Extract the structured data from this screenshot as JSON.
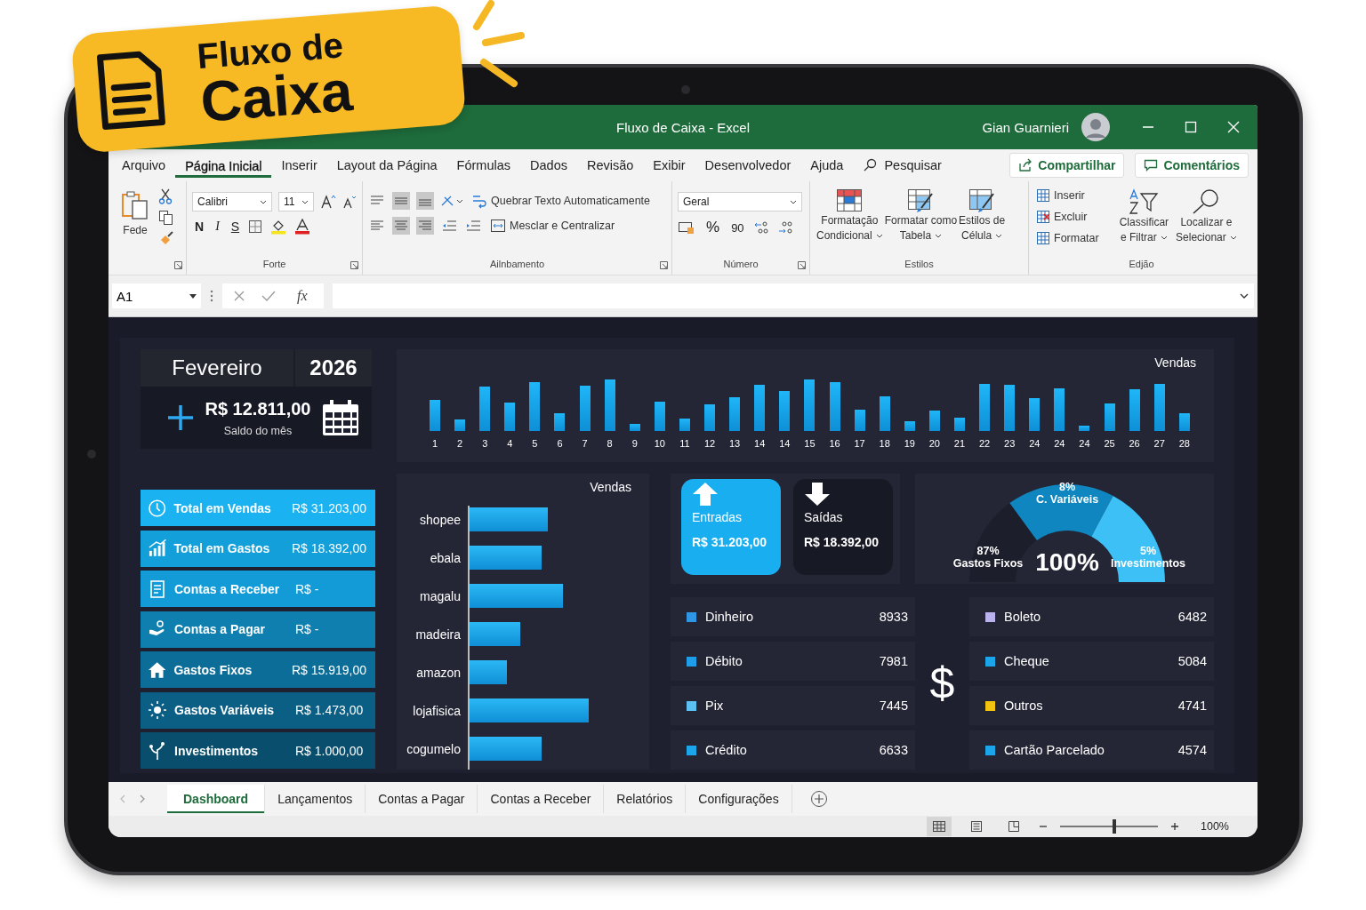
{
  "badge": {
    "line_1": "Fluxo de",
    "line_2": "Caixa"
  },
  "window": {
    "title": "Fluxo de Caixa - Excel",
    "user": "Gian Guarnieri"
  },
  "menu": {
    "tabs": [
      {
        "label": "Arquivo",
        "selected": false
      },
      {
        "label": "Página Inicial",
        "selected": true
      },
      {
        "label": "Inserir",
        "selected": false
      },
      {
        "label": "Layout da Página",
        "selected": false
      },
      {
        "label": "Fórmulas",
        "selected": false
      },
      {
        "label": "Dados",
        "selected": false
      },
      {
        "label": "Revisão",
        "selected": false
      },
      {
        "label": "Exibir",
        "selected": false
      },
      {
        "label": "Desenvolvedor",
        "selected": false
      },
      {
        "label": "Ajuda",
        "selected": false
      }
    ],
    "search": "Pesquisar",
    "share": "Compartilhar",
    "comments": "Comentários"
  },
  "ribbon": {
    "clipboard": {
      "paste": "Fede"
    },
    "font": {
      "family": "Calibri",
      "size": "11",
      "bold": "N",
      "italic": "I",
      "underline": "S",
      "label": "Forte"
    },
    "alignment": {
      "wrap": "Quebrar Texto Automaticamente",
      "merge": "Mesclar e Centralizar",
      "label": "Ailnbamento"
    },
    "number": {
      "format": "Geral",
      "percent": "%",
      "thousands": "90",
      "label": "Número"
    },
    "styles": {
      "items": [
        {
          "line_1": "Formatação",
          "line_2": "Condicional"
        },
        {
          "line_1": "Formatar como",
          "line_2": "Tabela"
        },
        {
          "line_1": "Estilos de",
          "line_2": "Célula"
        }
      ],
      "label": "Estilos"
    },
    "editing": {
      "cells": [
        "Inserir",
        "Excluir",
        "Formatar"
      ],
      "items": [
        {
          "line_1": "Classificar",
          "line_2": "e Filtrar"
        },
        {
          "line_1": "Localizar e",
          "line_2": "Selecionar"
        }
      ],
      "label": "Edjão"
    }
  },
  "formula_bar": {
    "name_box": "A1",
    "fx": "fx"
  },
  "dashboard": {
    "month": "Fevereiro",
    "year": "2026",
    "balance": "R$ 12.811,00",
    "balance_label": "Saldo do mês",
    "daily_chart": {
      "title": "Vendas",
      "labels": [
        "1",
        "2",
        "3",
        "4",
        "5",
        "6",
        "7",
        "8",
        "9",
        "10",
        "11",
        "12",
        "13",
        "14",
        "14",
        "15",
        "16",
        "17",
        "18",
        "19",
        "20",
        "21",
        "22",
        "23",
        "24",
        "24",
        "24",
        "25",
        "26",
        "27",
        "28"
      ]
    },
    "summary": [
      {
        "label": "Total em Vendas",
        "value": "R$ 31.203,00",
        "color": "#1ab2f0"
      },
      {
        "label": "Total em Gastos",
        "value": "R$ 18.392,00",
        "color": "#139fda"
      },
      {
        "label": "Contas a Receber",
        "value": "R$ -",
        "color": "#129bd6"
      },
      {
        "label": "Contas a Pagar",
        "value": "R$ -",
        "color": "#0e7fae"
      },
      {
        "label": "Gastos Fixos",
        "value": "R$ 15.919,00",
        "color": "#0c6e98"
      },
      {
        "label": "Gastos Variáveis",
        "value": "R$ 1.473,00",
        "color": "#0b5f84"
      },
      {
        "label": "Investimentos",
        "value": "R$ 1.000,00",
        "color": "#0a4e6d"
      }
    ],
    "platform_chart": {
      "title": "Vendas",
      "categories": [
        "shopee",
        "ebala",
        "magalu",
        "madeira",
        "amazon",
        "lojafisica",
        "cogumelo"
      ]
    },
    "flows": [
      {
        "label": "Entradas",
        "value": "R$ 31.203,00",
        "selected": true
      },
      {
        "label": "Saídas",
        "value": "R$ 18.392,00",
        "selected": false
      }
    ],
    "gauge": {
      "total": "100%",
      "segments": [
        {
          "percent": "87%",
          "label": "Gastos Fixos"
        },
        {
          "percent": "8%",
          "label": "C. Variáveis"
        },
        {
          "percent": "5%",
          "label": "Investimentos"
        }
      ]
    },
    "currency_sign": "$",
    "payments_left": [
      {
        "label": "Dinheiro",
        "value": "8933",
        "color": "#2f96e6"
      },
      {
        "label": "Débito",
        "value": "7981",
        "color": "#1e9ee8"
      },
      {
        "label": "Pix",
        "value": "7445",
        "color": "#5cc0f2"
      },
      {
        "label": "Crédito",
        "value": "6633",
        "color": "#1aa6e8"
      }
    ],
    "payments_right": [
      {
        "label": "Boleto",
        "value": "6482",
        "color": "#b9b2ee"
      },
      {
        "label": "Cheque",
        "value": "5084",
        "color": "#1aa6e8"
      },
      {
        "label": "Outros",
        "value": "4741",
        "color": "#f2c40f"
      },
      {
        "label": "Cartão Parcelado",
        "value": "4574",
        "color": "#1aa6e8"
      }
    ]
  },
  "sheet_tabs": [
    {
      "label": "Dashboard",
      "selected": true
    },
    {
      "label": "Lançamentos",
      "selected": false
    },
    {
      "label": "Contas a Pagar",
      "selected": false
    },
    {
      "label": "Contas a Receber",
      "selected": false
    },
    {
      "label": "Relatórios",
      "selected": false
    },
    {
      "label": "Configurações",
      "selected": false
    }
  ],
  "status_bar": {
    "zoom": "100%",
    "zoom_slider": {
      "level": 0.55
    }
  }
}
